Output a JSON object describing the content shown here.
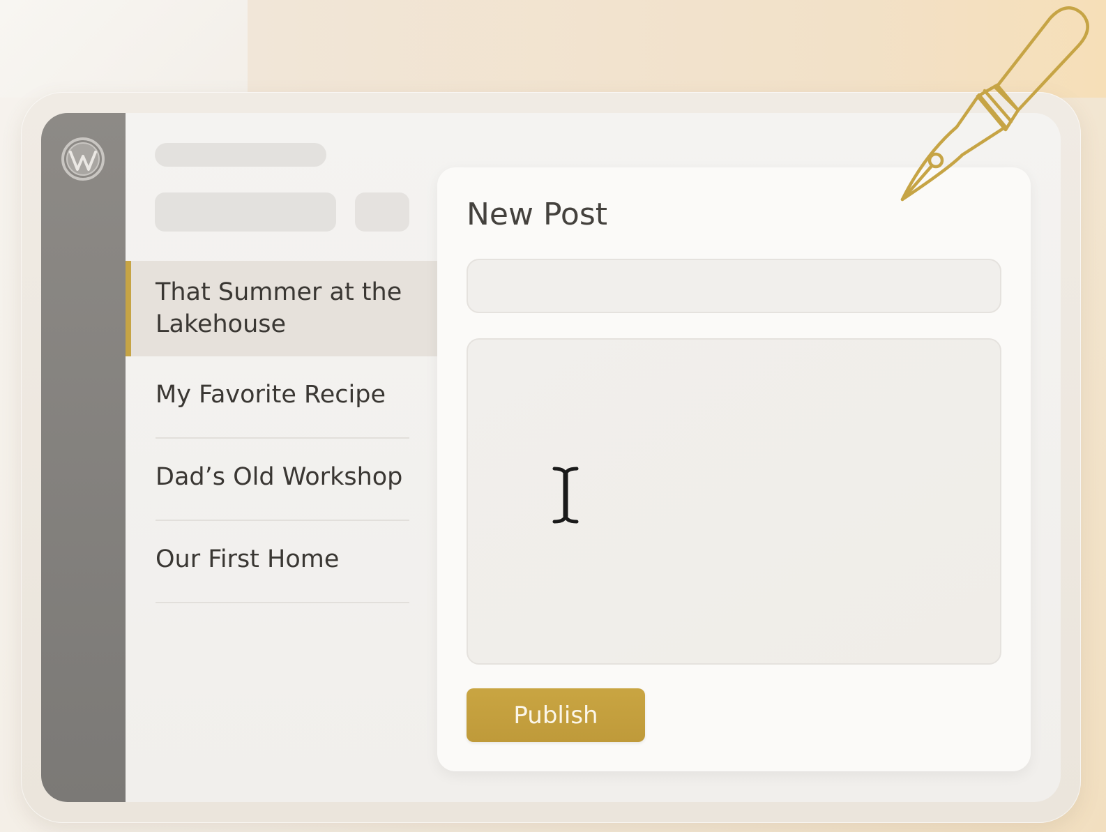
{
  "colors": {
    "accent": "#c6a445",
    "sidebar_bar": "#858280",
    "active_item_bg": "#e6e1db",
    "text": "#3a3733"
  },
  "icons": {
    "logo": "wordpress-logo-icon",
    "cursor": "text-cursor-icon",
    "decoration": "fountain-pen-icon"
  },
  "posts": [
    {
      "line1": "That Summer at the",
      "line2": "Lakehouse",
      "active": true
    },
    {
      "line1": "My Favorite Recipe",
      "active": false
    },
    {
      "line1": "Dad’s Old Workshop",
      "active": false
    },
    {
      "line1": "Our First Home",
      "active": false
    }
  ],
  "editor": {
    "title": "New Post",
    "title_input_value": "",
    "body_value": "",
    "publish_label": "Publish"
  }
}
